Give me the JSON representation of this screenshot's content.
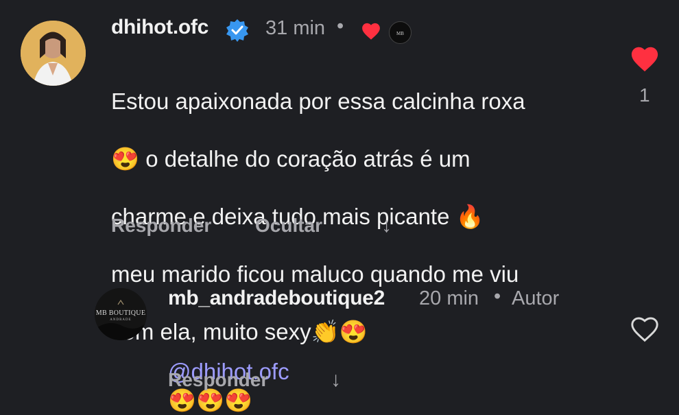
{
  "comments": [
    {
      "username": "dhihot.ofc",
      "time": "31 min",
      "text_lines": [
        "Estou apaixonada por essa calcinha roxa",
        "😍 o detalhe do coração atrás é um",
        "charme e deixa tudo mais picante 🔥",
        "meu marido ficou maluco quando me viu",
        "com ela, muito sexy👏😍"
      ],
      "like_count": "1",
      "reply_label": "Responder",
      "hide_label": "Ocultar",
      "arrow": "↓"
    },
    {
      "username": "mb_andradeboutique2",
      "time": "20 min",
      "badge": "Autor",
      "mention": "@dhihot.ofc",
      "emoji_text": "😍😍😍",
      "reply_label": "Responder",
      "arrow": "↓",
      "avatar_logo_line1": "MB BOUTIQUE",
      "avatar_logo_line2": "ANDRADE"
    }
  ],
  "colors": {
    "background": "#1e1f23",
    "text": "#f2f2f2",
    "secondary": "#a8a8ad",
    "heart": "#ff3040",
    "mention": "#9d9cff",
    "verified": "#3897f0"
  }
}
